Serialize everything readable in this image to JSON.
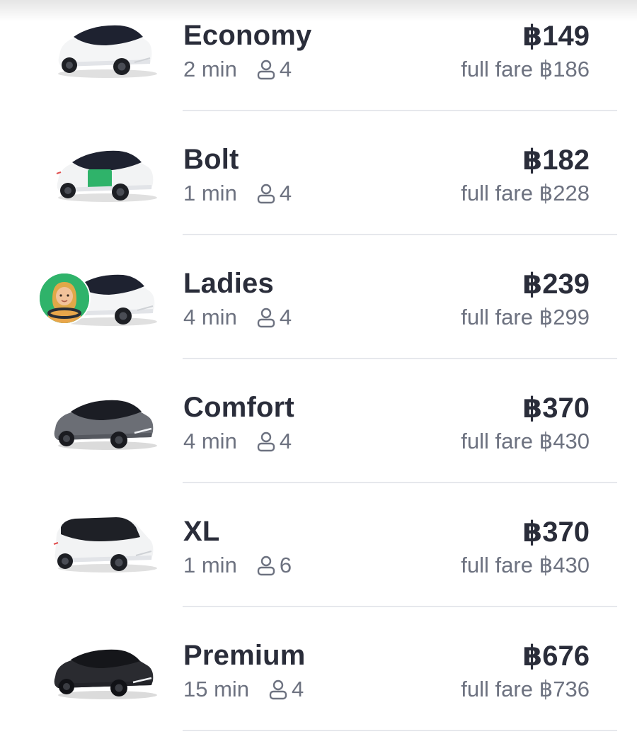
{
  "options": [
    {
      "name": "Economy",
      "eta": "2 min",
      "seats": "4",
      "price": "฿149",
      "full_fare": "full fare ฿186",
      "car_icon": "white-sedan-icon",
      "body_color": "#f4f5f6",
      "roof_color": "#1e2230"
    },
    {
      "name": "Bolt",
      "eta": "1 min",
      "seats": "4",
      "price": "฿182",
      "full_fare": "full fare ฿228",
      "car_icon": "white-green-sedan-icon",
      "body_color": "#f2f3f4",
      "roof_color": "#1e2230",
      "accent_color": "#2fb36a"
    },
    {
      "name": "Ladies",
      "eta": "4 min",
      "seats": "4",
      "price": "฿239",
      "full_fare": "full fare ฿299",
      "car_icon": "white-sedan-icon",
      "driver_icon": "woman-driver-icon",
      "body_color": "#f4f5f6",
      "roof_color": "#1e2230",
      "badge_color": "#2fb36a"
    },
    {
      "name": "Comfort",
      "eta": "4 min",
      "seats": "4",
      "price": "฿370",
      "full_fare": "full fare ฿430",
      "car_icon": "grey-sedan-icon",
      "body_color": "#6b6e75",
      "roof_color": "#1b1d24"
    },
    {
      "name": "XL",
      "eta": "1 min",
      "seats": "6",
      "price": "฿370",
      "full_fare": "full fare ฿430",
      "car_icon": "white-minivan-icon",
      "body_color": "#f2f3f4",
      "roof_color": "#1e2026"
    },
    {
      "name": "Premium",
      "eta": "15 min",
      "seats": "4",
      "price": "฿676",
      "full_fare": "full fare ฿736",
      "car_icon": "black-sedan-icon",
      "body_color": "#2a2b30",
      "roof_color": "#15161a"
    }
  ],
  "colors": {
    "text_primary": "#2a2d3a",
    "text_secondary": "#6d7280",
    "divider": "#e6e8ec"
  }
}
